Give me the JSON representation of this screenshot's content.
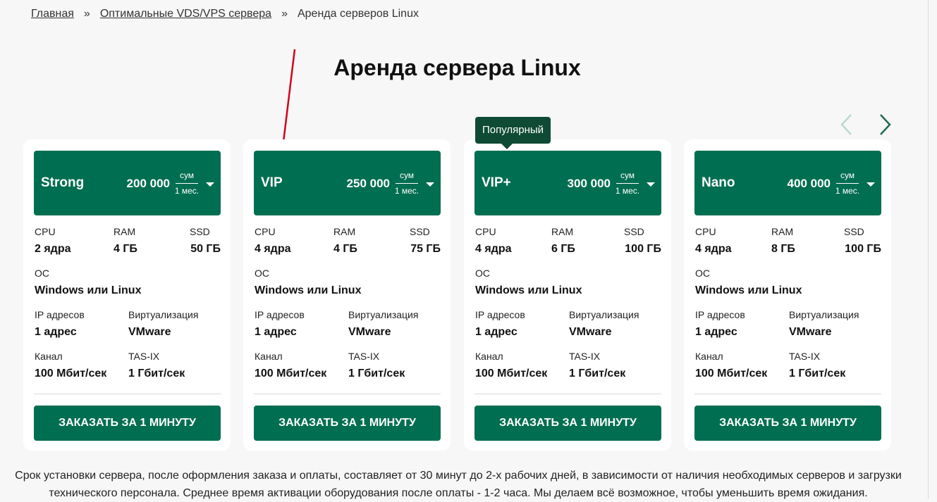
{
  "breadcrumb": {
    "home": "Главная",
    "separator": "»",
    "parent": "Оптимальные VDS/VPS сервера",
    "current": "Аренда серверов Linux"
  },
  "page": {
    "title": "Аренда сервера Linux"
  },
  "labels": {
    "cpu": "CPU",
    "ram": "RAM",
    "ssd": "SSD",
    "os": "ОС",
    "ip": "IP адресов",
    "virt": "Виртуализация",
    "channel": "Канал",
    "tasix": "TAS-IX",
    "unit_top": "сум",
    "unit_bottom": "1 мес.",
    "order_button": "ЗАКАЗАТЬ ЗА 1 МИНУТУ"
  },
  "popular_badge": "Популярный",
  "plans": [
    {
      "name": "Strong",
      "price": "200 000",
      "cpu": "2 ядра",
      "ram": "4 ГБ",
      "ssd": "50 ГБ",
      "os": "Windows или Linux",
      "ip": "1 адрес",
      "virt": "VMware",
      "channel": "100 Мбит/сек",
      "tasix": "1 Гбит/сек"
    },
    {
      "name": "VIP",
      "price": "250 000",
      "cpu": "4 ядра",
      "ram": "4 ГБ",
      "ssd": "75 ГБ",
      "os": "Windows или Linux",
      "ip": "1 адрес",
      "virt": "VMware",
      "channel": "100 Мбит/сек",
      "tasix": "1 Гбит/сек"
    },
    {
      "name": "VIP+",
      "price": "300 000",
      "cpu": "4 ядра",
      "ram": "6 ГБ",
      "ssd": "100 ГБ",
      "os": "Windows или Linux",
      "ip": "1 адрес",
      "virt": "VMware",
      "channel": "100 Мбит/сек",
      "tasix": "1 Гбит/сек"
    },
    {
      "name": "Nano",
      "price": "400 000",
      "cpu": "4 ядра",
      "ram": "8 ГБ",
      "ssd": "100 ГБ",
      "os": "Windows или Linux",
      "ip": "1 адрес",
      "virt": "VMware",
      "channel": "100 Мбит/сек",
      "tasix": "1 Гбит/сек"
    }
  ],
  "footer": {
    "note": "Срок установки сервера, после оформления заказа и оплаты, составляет от 30 минут до 2-х рабочих дней, в зависимости от наличия необходимых серверов и загрузки технического персонала. Среднее время активации оборудования после оплаты - 1-2 часа. Мы делаем всё возможное, чтобы уменьшить время ожидания."
  },
  "icons": {
    "prev": "chevron-left-icon",
    "next": "chevron-right-icon",
    "dropdown": "caret-down-icon",
    "annotation": "red-arrow-annotation"
  },
  "colors": {
    "brand_green": "#006e51",
    "tooltip": "#0f4a34",
    "arrow_annotation": "#d0021b",
    "nav_disabled": "#b9d9cf",
    "nav_active": "#1f6b56"
  }
}
